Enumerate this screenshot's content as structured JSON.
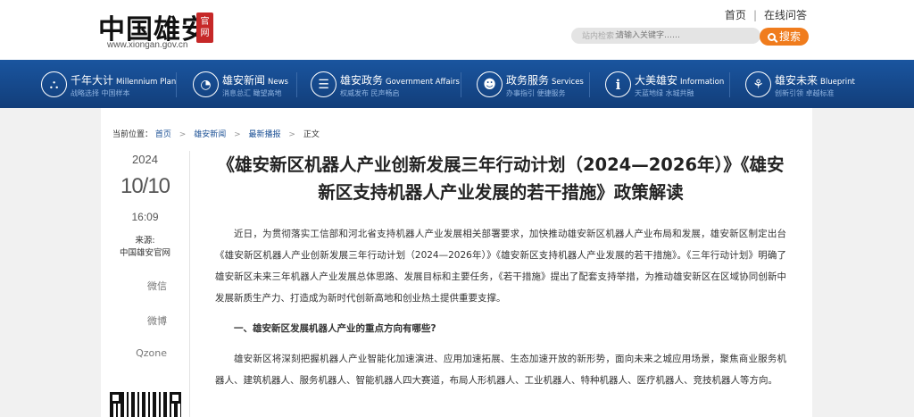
{
  "header": {
    "logo_text": "中国雄安",
    "logo_seal": "官网",
    "logo_url": "www.xiongan.gov.cn",
    "links": {
      "home": "首页",
      "separator": "|",
      "consult": "在线问答"
    },
    "search": {
      "label": "站内检索：",
      "placeholder": "请输入关键字……",
      "button": "搜索"
    }
  },
  "nav": [
    {
      "title": "千年大计",
      "en": "Millennium Plan",
      "sub": "战略选择  中国样本",
      "icon": "millennium-icon",
      "glyph": "⛬"
    },
    {
      "title": "雄安新闻",
      "en": "News",
      "sub": "消息总汇  瞰望高地",
      "icon": "news-icon",
      "glyph": "◔"
    },
    {
      "title": "雄安政务",
      "en": "Government Affairs",
      "sub": "权威发布  民声畅启",
      "icon": "chat-icon",
      "glyph": "☰"
    },
    {
      "title": "政务服务",
      "en": "Services",
      "sub": "办事指引  便捷服务",
      "icon": "user-icon",
      "glyph": "☻"
    },
    {
      "title": "大美雄安",
      "en": "Information",
      "sub": "天蓝地绿  水城共融",
      "icon": "info-icon",
      "glyph": "i"
    },
    {
      "title": "雄安未来",
      "en": "Blueprint",
      "sub": "创新引领  卓越标准",
      "icon": "blueprint-icon",
      "glyph": "⚘"
    }
  ],
  "breadcrumb": {
    "label": "当前位置：",
    "items": [
      "首页",
      "雄安新闻",
      "最新播报"
    ],
    "current": "正文",
    "separator": ">"
  },
  "meta": {
    "year": "2024",
    "date": "10/10",
    "time": "16:09",
    "source_label": "来源:",
    "source": "中国雄安官网"
  },
  "share": {
    "wechat": "微信",
    "weibo": "微博",
    "qzone": "Qzone"
  },
  "article": {
    "title": "《雄安新区机器人产业创新发展三年行动计划（2024—2026年）》《雄安新区支持机器人产业发展的若干措施》政策解读",
    "intro": "近日，为贯彻落实工信部和河北省支持机器人产业发展相关部署要求，加快推动雄安新区机器人产业布局和发展，雄安新区制定出台《雄安新区机器人产业创新发展三年行动计划（2024—2026年）》《雄安新区支持机器人产业发展的若干措施》。《三年行动计划》明确了雄安新区未来三年机器人产业发展总体思路、发展目标和主要任务，《若干措施》提出了配套支持举措，为推动雄安新区在区域协同创新中发展新质生产力、打造成为新时代创新高地和创业热土提供重要支撑。",
    "heading1": "一、雄安新区发展机器人产业的重点方向有哪些?",
    "para1": "雄安新区将深刻把握机器人产业智能化加速演进、应用加速拓展、生态加速开放的新形势，面向未来之城应用场景，聚焦商业服务机器人、建筑机器人、服务机器人、智能机器人四大赛道，布局人形机器人、工业机器人、特种机器人、医疗机器人、竞技机器人等方向。"
  }
}
